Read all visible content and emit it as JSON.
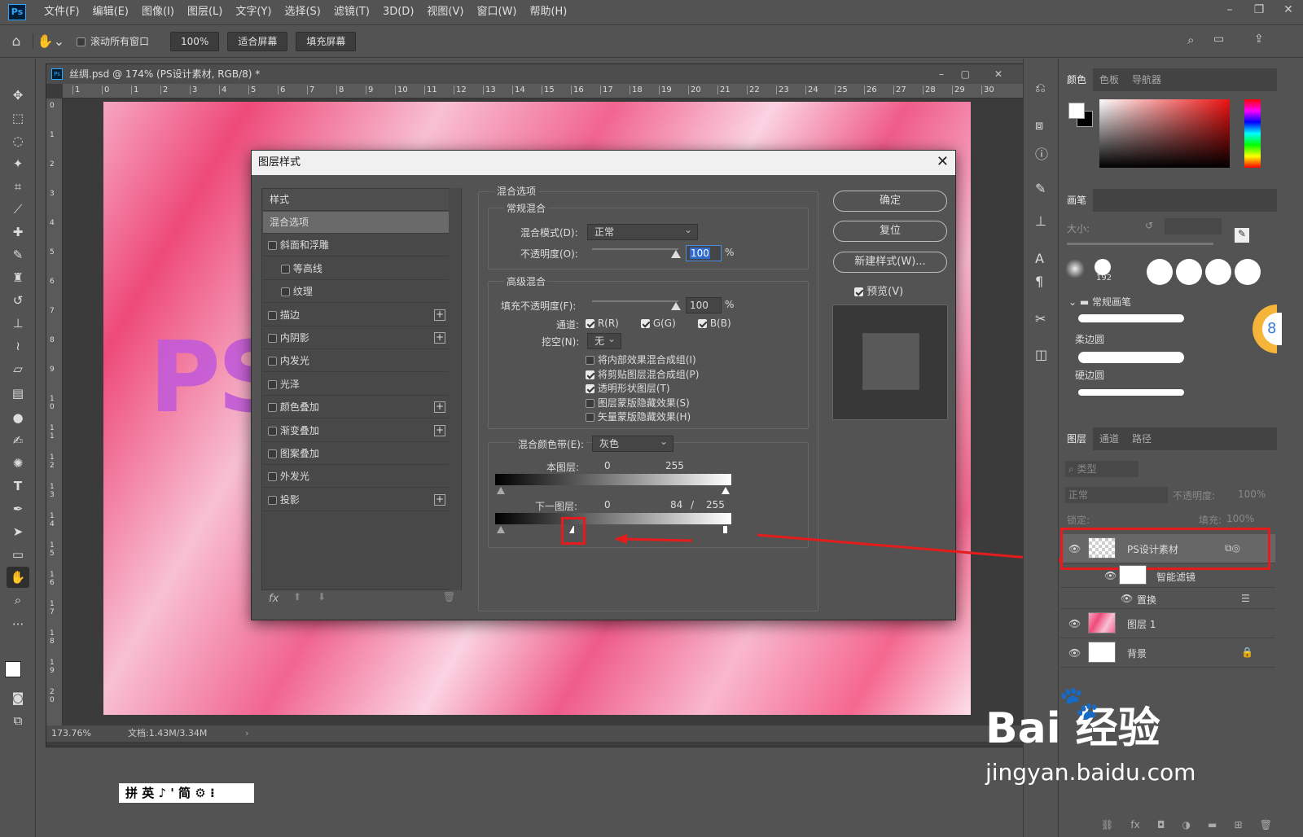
{
  "menubar": {
    "logo": "Ps",
    "items": [
      "文件(F)",
      "编辑(E)",
      "图像(I)",
      "图层(L)",
      "文字(Y)",
      "选择(S)",
      "滤镜(T)",
      "3D(D)",
      "视图(V)",
      "窗口(W)",
      "帮助(H)"
    ]
  },
  "options": {
    "scroll_all": "滚动所有窗口",
    "zoom": "100%",
    "fit_screen": "适合屏幕",
    "fill_screen": "填充屏幕"
  },
  "document": {
    "title": "丝绸.psd @ 174% (PS设计素材, RGB/8) *",
    "canvas_text": "PS",
    "status_zoom": "173.76%",
    "status_doc": "文档:1.43M/3.34M",
    "ruler_h": [
      "1",
      "0",
      "1",
      "2",
      "3",
      "4",
      "5",
      "6",
      "7",
      "8",
      "9",
      "10",
      "11",
      "12",
      "13",
      "14",
      "15",
      "16",
      "17",
      "18",
      "19",
      "20",
      "21",
      "22",
      "23",
      "24",
      "25",
      "26",
      "27",
      "28",
      "29",
      "30"
    ],
    "ruler_v": [
      "0",
      "1",
      "2",
      "3",
      "4",
      "5",
      "6",
      "7",
      "8",
      "9",
      "1\n0",
      "1\n1",
      "1\n2",
      "1\n3",
      "1\n4",
      "1\n5",
      "1\n6",
      "1\n7",
      "1\n8",
      "1\n9",
      "2\n0"
    ]
  },
  "dialog": {
    "title": "图层样式",
    "styles_header": "样式",
    "styles": [
      {
        "label": "混合选项",
        "selected": true,
        "checkbox": false,
        "plus": false,
        "indent": false
      },
      {
        "label": "斜面和浮雕",
        "checkbox": true,
        "plus": false,
        "indent": false
      },
      {
        "label": "等高线",
        "checkbox": true,
        "plus": false,
        "indent": true
      },
      {
        "label": "纹理",
        "checkbox": true,
        "plus": false,
        "indent": true
      },
      {
        "label": "描边",
        "checkbox": true,
        "plus": true,
        "indent": false
      },
      {
        "label": "内阴影",
        "checkbox": true,
        "plus": true,
        "indent": false
      },
      {
        "label": "内发光",
        "checkbox": true,
        "plus": false,
        "indent": false
      },
      {
        "label": "光泽",
        "checkbox": true,
        "plus": false,
        "indent": false
      },
      {
        "label": "颜色叠加",
        "checkbox": true,
        "plus": true,
        "indent": false
      },
      {
        "label": "渐变叠加",
        "checkbox": true,
        "plus": true,
        "indent": false
      },
      {
        "label": "图案叠加",
        "checkbox": true,
        "plus": false,
        "indent": false
      },
      {
        "label": "外发光",
        "checkbox": true,
        "plus": false,
        "indent": false
      },
      {
        "label": "投影",
        "checkbox": true,
        "plus": true,
        "indent": false
      }
    ],
    "fx_label": "fx",
    "blend_options": "混合选项",
    "normal_blend": "常规混合",
    "blend_mode_label": "混合模式(D):",
    "blend_mode_value": "正常",
    "opacity_label": "不透明度(O):",
    "opacity_value": "100",
    "percent": "%",
    "advanced_blend": "高级混合",
    "fill_opacity_label": "填充不透明度(F):",
    "fill_opacity_value": "100",
    "channels_label": "通道:",
    "ch_r": "R(R)",
    "ch_g": "G(G)",
    "ch_b": "B(B)",
    "knockout_label": "挖空(N):",
    "knockout_value": "无",
    "options": [
      {
        "label": "将内部效果混合成组(I)",
        "checked": false
      },
      {
        "label": "将剪贴图层混合成组(P)",
        "checked": true
      },
      {
        "label": "透明形状图层(T)",
        "checked": true
      },
      {
        "label": "图层蒙版隐藏效果(S)",
        "checked": false
      },
      {
        "label": "矢量蒙版隐藏效果(H)",
        "checked": false
      }
    ],
    "blend_if_label": "混合颜色带(E):",
    "blend_if_value": "灰色",
    "this_layer_label": "本图层:",
    "this_low": "0",
    "this_high": "255",
    "under_layer_label": "下一图层:",
    "under_low": "0",
    "under_split": "84",
    "under_slash": "/",
    "under_high": "255",
    "under_split_fraction": 0.33,
    "ok": "确定",
    "reset": "复位",
    "new_style": "新建样式(W)...",
    "preview": "预览(V)"
  },
  "panels": {
    "color_tabs": [
      "颜色",
      "色板",
      "导航器"
    ],
    "brush_tab": "画笔",
    "size_label": "大小:",
    "brush_size": "192",
    "brush_group": "常规画笔",
    "brush_soft": "柔边圆",
    "brush_hard": "硬边圆",
    "layer_tabs": [
      "图层",
      "通道",
      "路径"
    ],
    "filter_type": "类型",
    "blend_mode": "正常",
    "opacity_label": "不透明度:",
    "opacity": "100%",
    "lock_label": "锁定:",
    "fill_label": "填充:",
    "fill": "100%",
    "layers": [
      {
        "name": "PS设计素材",
        "selected": true
      },
      {
        "name": "智能滤镜",
        "sub": true
      },
      {
        "name": "置换",
        "sub2": true
      },
      {
        "name": "图层 1"
      },
      {
        "name": "背景",
        "locked": true
      }
    ]
  },
  "ime": "拼 英 ♪ ' 简 ⚙ ⁝",
  "watermark": {
    "brand": "Bai  经验",
    "url": "jingyan.baidu.com"
  },
  "colors": {
    "accent_red": "#e61c1c",
    "ui_bg": "#535353"
  }
}
